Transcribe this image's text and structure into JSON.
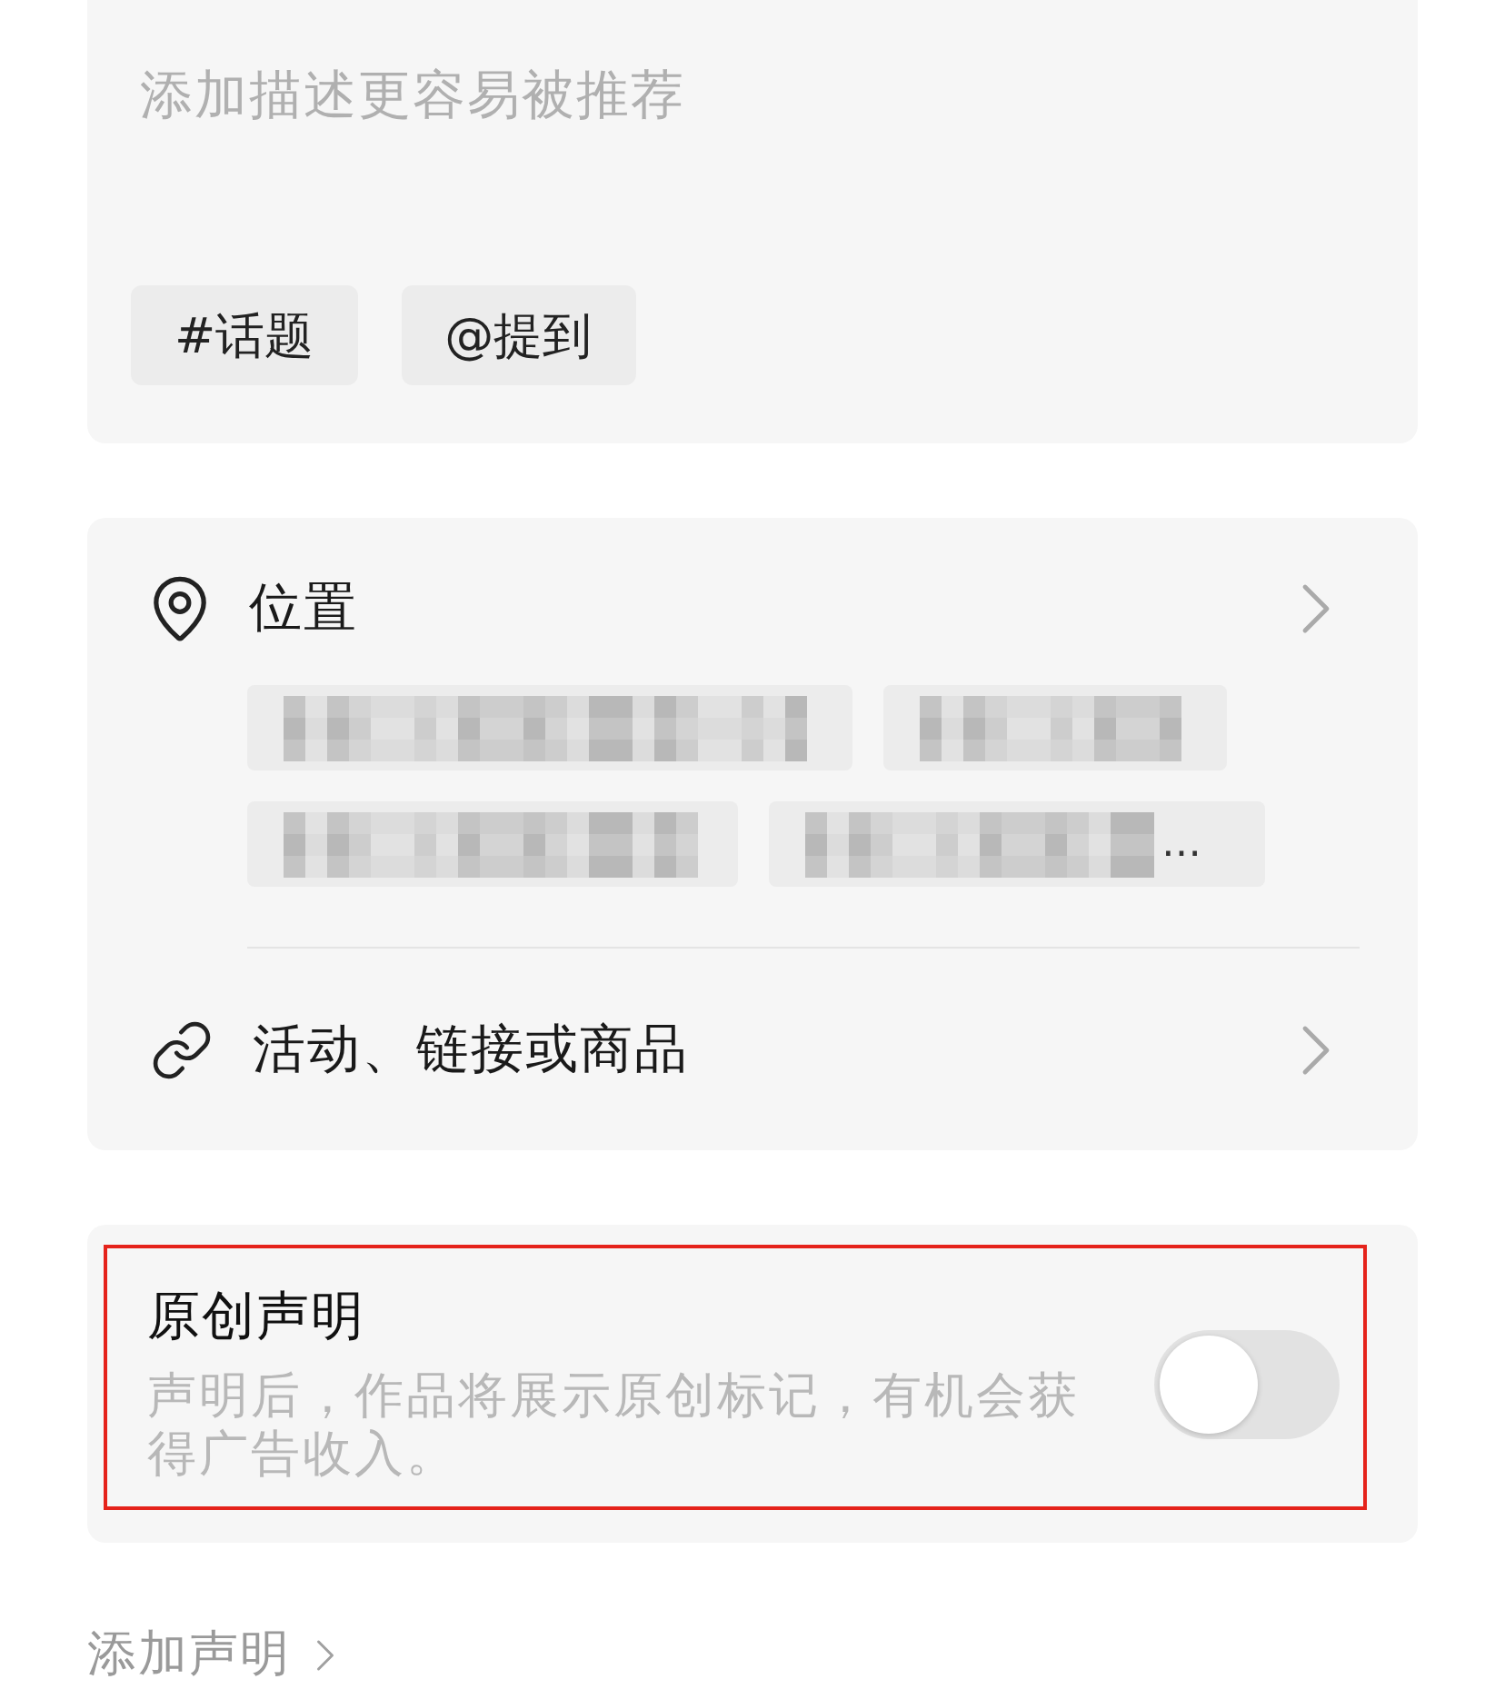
{
  "description": {
    "placeholder": "添加描述更容易被推荐"
  },
  "quick_tags": [
    {
      "label": "#话题"
    },
    {
      "label": "@提到"
    }
  ],
  "location": {
    "label": "位置",
    "suggestions": [
      {
        "blurred": true
      },
      {
        "blurred": true
      },
      {
        "blurred": true
      },
      {
        "blurred": true,
        "overflow_mark": "…"
      }
    ]
  },
  "link_row": {
    "label": "活动、链接或商品"
  },
  "originality": {
    "title": "原创声明",
    "description": "声明后，作品将展示原创标记，有机会获得广告收入。",
    "on": false,
    "highlighted": true
  },
  "add_statement": {
    "label": "添加声明"
  }
}
